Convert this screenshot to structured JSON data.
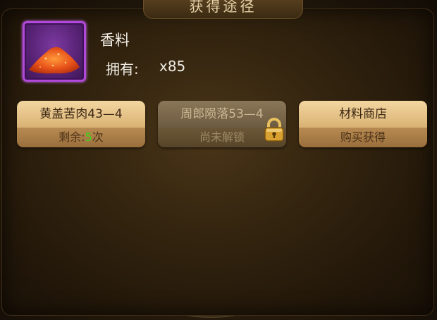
{
  "header": {
    "title": "获得途径"
  },
  "item": {
    "icon": "spice-powder-icon",
    "name": "香料",
    "own_label": "拥有:",
    "own_value": "x85"
  },
  "sources": [
    {
      "title": "黄盖苦肉43—4",
      "sub_prefix": "剩余:",
      "sub_count": "5",
      "sub_suffix": "次",
      "locked": false
    },
    {
      "title": "周郎陨落53—4",
      "sub": "尚未解锁",
      "locked": true
    },
    {
      "title": "材料商店",
      "sub": "购买获得",
      "locked": false
    }
  ],
  "colors": {
    "accent_green": "#3ed414",
    "item_border": "#b048d8"
  }
}
